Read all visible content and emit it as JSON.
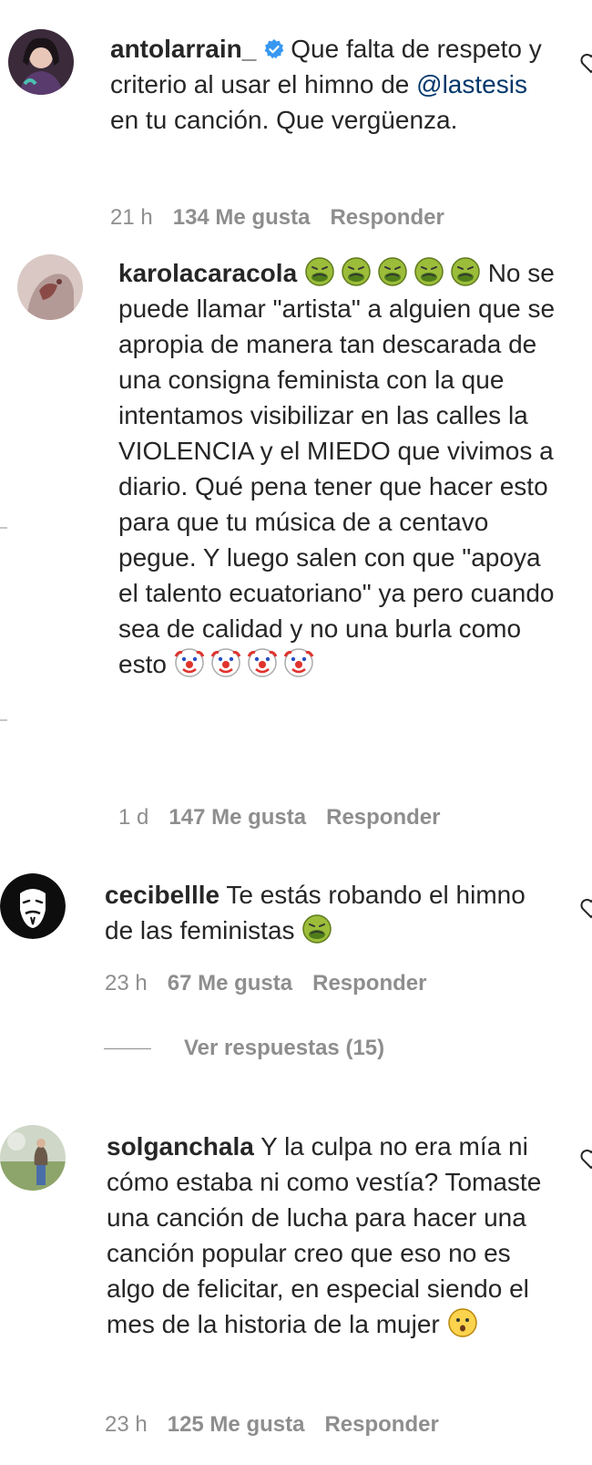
{
  "comments": [
    {
      "username": "antolarrain_",
      "verified": true,
      "text_before_mention": "Que falta de respeto y criterio al usar el himno de ",
      "mention": "@lastesis",
      "text_after_mention": " en tu canción. Que vergüenza.",
      "time": "21 h",
      "likes": "134 Me gusta",
      "reply": "Responder"
    },
    {
      "username": "karolacaracola",
      "lead_emoji": [
        "nauseated-face",
        "nauseated-face",
        "nauseated-face",
        "nauseated-face",
        "nauseated-face"
      ],
      "text": "No se puede llamar \"artista\" a alguien que se apropia de manera tan descarada de una consigna feminista con la que intentamos visibilizar en las calles la VIOLENCIA y el MIEDO que vivimos a diario. Qué pena tener que hacer esto para que tu música de a centavo pegue. Y luego salen con que \"apoya el talento ecuatoriano\" ya pero cuando sea de calidad y no una burla como esto",
      "trail_emoji": [
        "clown-face",
        "clown-face",
        "clown-face",
        "clown-face"
      ],
      "time": "1 d",
      "likes": "147 Me gusta",
      "reply": "Responder"
    },
    {
      "username": "cecibellle",
      "text": "Te estás robando el himno de las feministas",
      "trail_emoji": [
        "nauseated-face"
      ],
      "time": "23 h",
      "likes": "67 Me gusta",
      "reply": "Responder",
      "view_replies": "Ver respuestas (15)"
    },
    {
      "username": "solganchala",
      "text": "Y la culpa no era mía ni cómo estaba ni como vestía? Tomaste una canción de lucha para hacer una canción popular creo que eso no es algo de felicitar, en especial siendo el mes de la historia de la mujer",
      "trail_emoji": [
        "hushed-face"
      ],
      "time": "23 h",
      "likes": "125 Me gusta",
      "reply": "Responder"
    }
  ],
  "colors": {
    "text": "#262626",
    "meta": "#8e8e8e",
    "mention": "#00376b",
    "verified": "#3897f0"
  }
}
